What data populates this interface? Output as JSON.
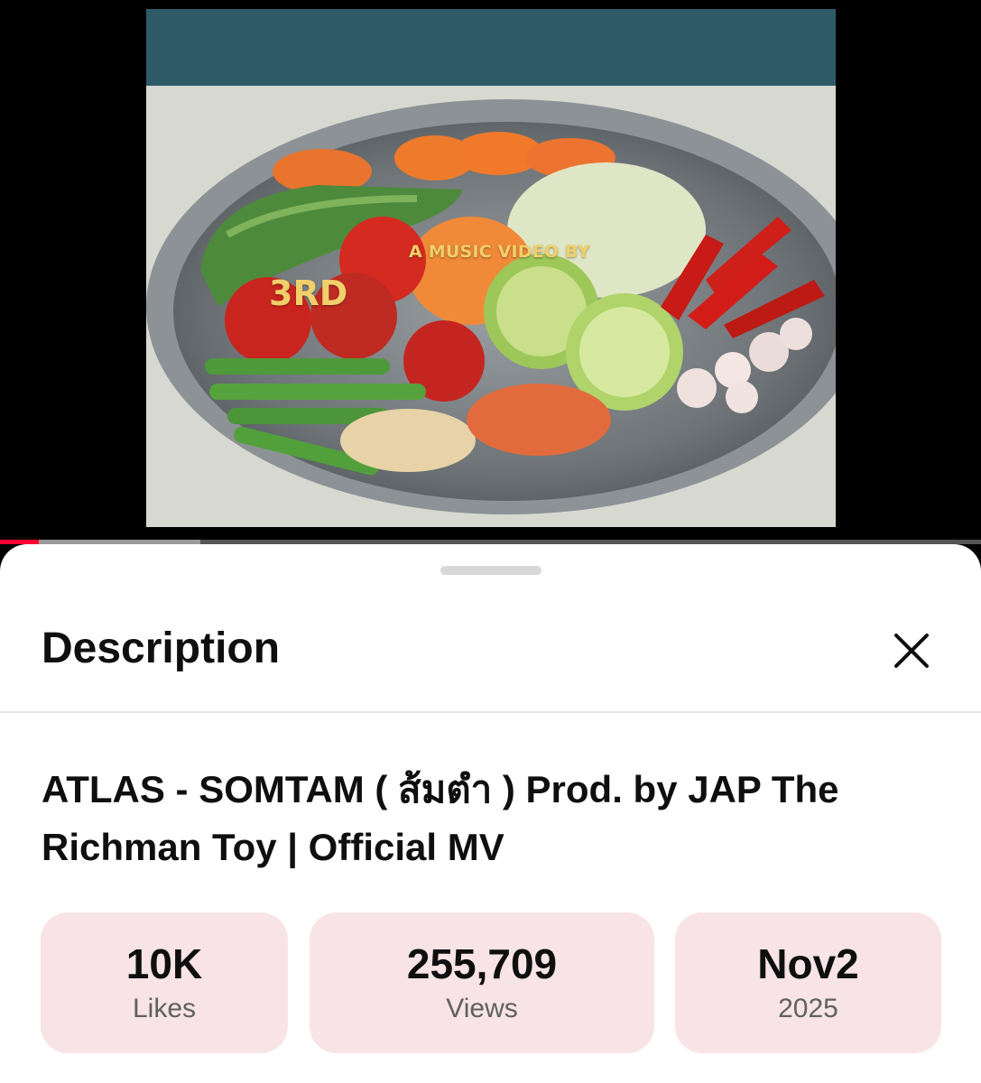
{
  "video": {
    "overlay_by": "A MUSIC VIDEO BY",
    "overlay_artist": "3RD",
    "progress_played": 0.04,
    "progress_buffered": 0.204
  },
  "sheet": {
    "title": "Description",
    "close_icon": "close-icon"
  },
  "video_title": "ATLAS - SOMTAM ( ส้มตำ ) Prod. by JAP The Richman Toy | Official MV",
  "stats": {
    "likes": {
      "value": "10K",
      "label": "Likes"
    },
    "views": {
      "value": "255,709",
      "label": "Views"
    },
    "date": {
      "value": "Nov2",
      "label": "2025"
    }
  },
  "colors": {
    "stat_bg": "#f8e4e6",
    "progress": "#ff0033",
    "overlay_text": "#f1cf6a"
  }
}
